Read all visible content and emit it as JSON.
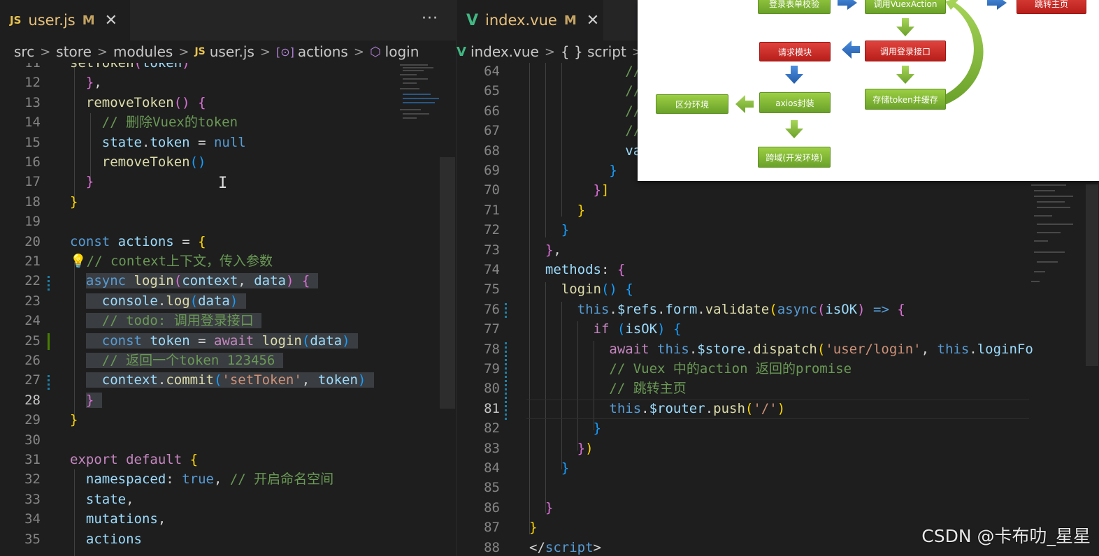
{
  "left_editor": {
    "tab": {
      "icon": "JS",
      "label": "user.js",
      "modified": "M",
      "close": "✕"
    },
    "more": "···",
    "breadcrumb": [
      "src",
      "store",
      "modules",
      "user.js",
      "actions",
      "login"
    ],
    "breadcrumb_icons": {
      "file": "JS",
      "actions": "[⊙]",
      "login": "⬡"
    },
    "lines": [
      {
        "n": "11",
        "html": "<span class='f'>setToken</span><span class='b2'>(</span><span class='v'>token</span><span class='b2'>)</span>"
      },
      {
        "n": "12",
        "html": "  <span class='b2'>}</span><span class='p'>,</span>"
      },
      {
        "n": "13",
        "html": "  <span class='f'>removeToken</span><span class='b2'>()</span> <span class='b2'>{</span>"
      },
      {
        "n": "14",
        "html": "    <span class='c'>// 删除Vuex的token</span>"
      },
      {
        "n": "15",
        "html": "    <span class='v'>state</span><span class='p'>.</span><span class='v'>token</span> <span class='p'>=</span> <span class='t'>null</span>"
      },
      {
        "n": "16",
        "html": "    <span class='f'>removeToken</span><span class='b3'>()</span>"
      },
      {
        "n": "17",
        "html": "  <span class='b2'>}</span>"
      },
      {
        "n": "18",
        "html": "<span class='b1'>}</span>"
      },
      {
        "n": "19",
        "html": ""
      },
      {
        "n": "20",
        "html": "<span class='k'>const</span> <span class='v'>actions</span> <span class='p'>=</span> <span class='b1'>{</span>"
      },
      {
        "n": "21",
        "html": "<span class='bulb-icon' data-name='lightbulb-icon'>💡</span><span class='c'>// context上下文，传入参数</span>"
      },
      {
        "n": "22",
        "html": "  <span class='sel'><span class='k'>async</span> <span class='f'>login</span><span class='b2'>(</span><span class='v'>context</span><span class='p'>,</span> <span class='v'>data</span><span class='b2'>)</span> <span class='b2'>{</span> </span>"
      },
      {
        "n": "23",
        "html": "  <span class='sel'>  <span class='v'>console</span><span class='p'>.</span><span class='f'>log</span><span class='b3'>(</span><span class='v'>data</span><span class='b3'>)</span> </span>"
      },
      {
        "n": "24",
        "html": "  <span class='sel'>  <span class='c'>// todo: 调用登录接口</span> </span>"
      },
      {
        "n": "25",
        "html": "  <span class='sel'>  <span class='k'>const</span> <span class='v'>token</span> <span class='p'>=</span> <span class='kc'>await</span> <span class='f'>login</span><span class='b3'>(</span><span class='v'>data</span><span class='b3'>)</span> </span>"
      },
      {
        "n": "26",
        "html": "  <span class='sel'>  <span class='c'>// 返回一个token 123456</span> </span>"
      },
      {
        "n": "27",
        "html": "  <span class='sel'>  <span class='v'>context</span><span class='p'>.</span><span class='f'>commit</span><span class='b3'>(</span><span class='s'>'setToken'</span><span class='p'>,</span> <span class='v'>token</span><span class='b3'>)</span> </span>"
      },
      {
        "n": "28",
        "html": "  <span class='sel'><span class='b2'>}</span> </span>"
      },
      {
        "n": "29",
        "html": "<span class='b1'>}</span>"
      },
      {
        "n": "30",
        "html": ""
      },
      {
        "n": "31",
        "html": "<span class='kc'>export</span> <span class='kc'>default</span> <span class='b1'>{</span>"
      },
      {
        "n": "32",
        "html": "  <span class='v'>namespaced</span><span class='p'>:</span> <span class='t'>true</span><span class='p'>,</span> <span class='c'>// 开启命名空间</span>"
      },
      {
        "n": "33",
        "html": "  <span class='v'>state</span><span class='p'>,</span>"
      },
      {
        "n": "34",
        "html": "  <span class='v'>mutations</span><span class='p'>,</span>"
      },
      {
        "n": "35",
        "html": "  <span class='v'>actions</span>"
      }
    ],
    "active_line": "28"
  },
  "right_editor": {
    "tab": {
      "icon": "V",
      "label": "index.vue",
      "modified": "M",
      "close": "✕"
    },
    "breadcrumb": [
      "index.vue",
      "{ } script",
      "[⊙"
    ],
    "lines": [
      {
        "n": "64",
        "html": "            <span class='c'>//</span>"
      },
      {
        "n": "65",
        "html": "            <span class='c'>//</span>"
      },
      {
        "n": "66",
        "html": "            <span class='c'>//</span>"
      },
      {
        "n": "67",
        "html": "            <span class='c'>//</span>"
      },
      {
        "n": "68",
        "html": "            <span class='v'>va</span>"
      },
      {
        "n": "69",
        "html": "          <span class='b3'>}</span>"
      },
      {
        "n": "70",
        "html": "        <span class='b2'>}</span><span class='b1'>]</span>"
      },
      {
        "n": "71",
        "html": "      <span class='b1'>}</span>"
      },
      {
        "n": "72",
        "html": "    <span class='b3'>}</span>"
      },
      {
        "n": "73",
        "html": "  <span class='b2'>}</span><span class='p'>,</span>"
      },
      {
        "n": "74",
        "html": "  <span class='v'>methods</span><span class='p'>:</span> <span class='b2'>{</span>"
      },
      {
        "n": "75",
        "html": "    <span class='f'>login</span><span class='b3'>()</span> <span class='b3'>{</span>"
      },
      {
        "n": "76",
        "html": "      <span class='t'>this</span><span class='p'>.</span><span class='v'>$refs</span><span class='p'>.</span><span class='v'>form</span><span class='p'>.</span><span class='f'>validate</span><span class='b1'>(</span><span class='k'>async</span><span class='b2'>(</span><span class='v'>isOK</span><span class='b2'>)</span> <span class='k'>=&gt;</span> <span class='b2'>{</span>"
      },
      {
        "n": "77",
        "html": "        <span class='kc'>if</span> <span class='b3'>(</span><span class='v'>isOK</span><span class='b3'>)</span> <span class='b3'>{</span>"
      },
      {
        "n": "78",
        "html": "          <span class='kc'>await</span> <span class='t'>this</span><span class='p'>.</span><span class='v'>$store</span><span class='p'>.</span><span class='f'>dispatch</span><span class='b1'>(</span><span class='s'>'user/login'</span><span class='p'>,</span> <span class='t'>this</span><span class='p'>.</span><span class='v'>loginFo</span>"
      },
      {
        "n": "79",
        "html": "          <span class='c'>// Vuex 中的action 返回的promise</span>"
      },
      {
        "n": "80",
        "html": "          <span class='c'>// 跳转主页</span>"
      },
      {
        "n": "81",
        "html": "          <span class='t'>this</span><span class='p'>.</span><span class='v'>$router</span><span class='p'>.</span><span class='f'>push</span><span class='b1'>(</span><span class='s'>'/'</span><span class='b1'>)</span>"
      },
      {
        "n": "82",
        "html": "        <span class='b3'>}</span>"
      },
      {
        "n": "83",
        "html": "      <span class='b2'>}</span><span class='b1'>)</span>"
      },
      {
        "n": "84",
        "html": "    <span class='b3'>}</span>"
      },
      {
        "n": "85",
        "html": ""
      },
      {
        "n": "86",
        "html": "  <span class='b2'>}</span>"
      },
      {
        "n": "87",
        "html": "<span class='b1'>}</span>"
      },
      {
        "n": "88",
        "html": "<span class='p'>&lt;/</span><span class='k'>script</span><span class='p'>&gt;</span>"
      }
    ],
    "active_line": "81"
  },
  "diagram": {
    "nodes": {
      "form_validate": "登录表单校验",
      "call_vuex_action": "调用VuexAction",
      "jump_home": "跳转主页",
      "request_module": "请求模块",
      "call_login_api": "调用登录接口",
      "env_split": "区分环境",
      "axios_wrap": "axios封装",
      "store_token": "存储token并缓存",
      "cors_dev": "跨域(开发环境)"
    },
    "colors": {
      "green": "#7cb531",
      "red": "#d0312d",
      "blue_arrow": "#2f6fc2",
      "green_arrow": "#7cb531"
    }
  },
  "watermark": "CSDN @卡布叻_星星"
}
